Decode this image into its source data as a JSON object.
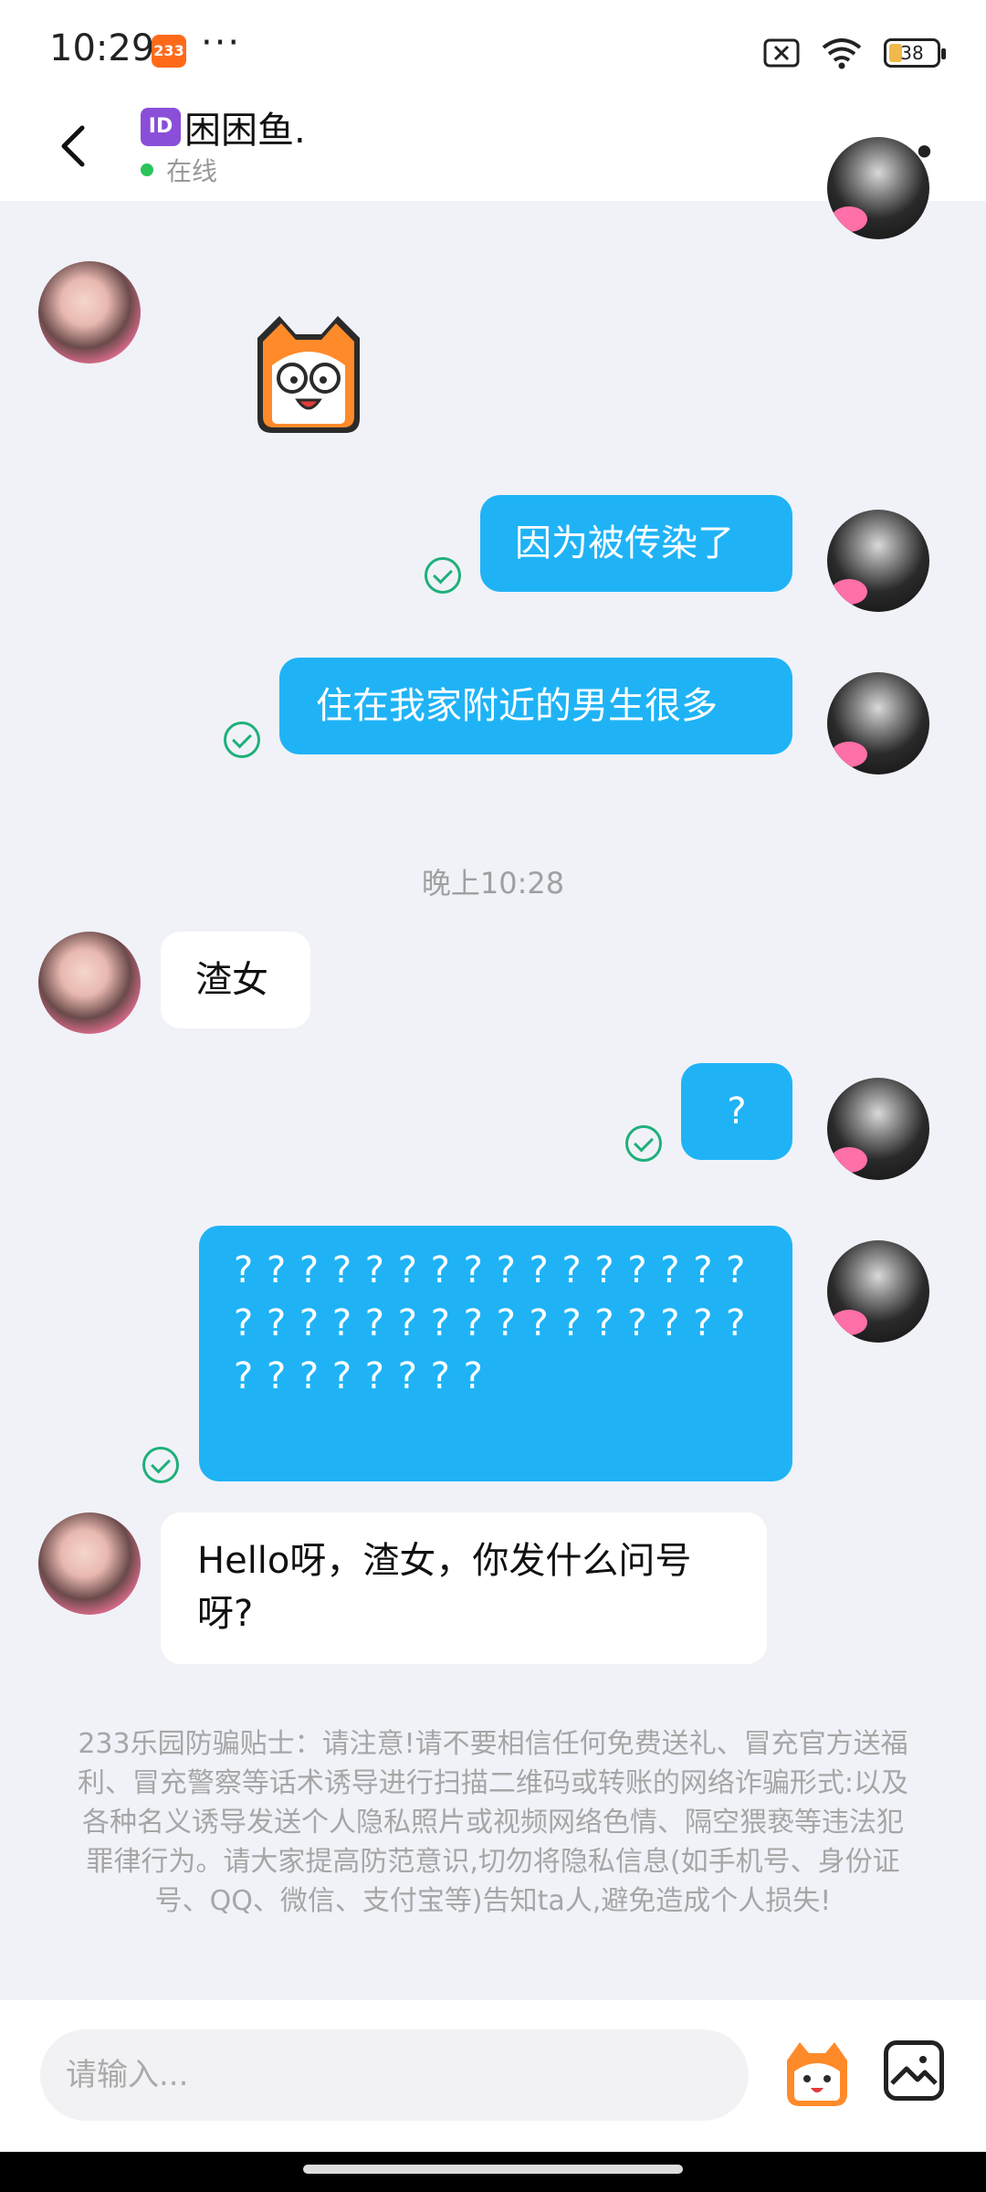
{
  "status_bar": {
    "time": "10:29",
    "app_badge": "233",
    "more": "···",
    "battery": "38"
  },
  "header": {
    "id_badge": "ID",
    "name": "困困鱼.",
    "status": "在线"
  },
  "messages": [
    {
      "side": "in",
      "type": "sticker"
    },
    {
      "side": "out",
      "text": "因为被传染了"
    },
    {
      "side": "out",
      "text": "住在我家附近的男生很多"
    },
    {
      "side": "in",
      "text": "渣女"
    },
    {
      "side": "out",
      "text": "?"
    },
    {
      "side": "out",
      "text": "? ? ? ? ? ? ? ? ? ? ? ? ? ? ? ? ? ? ? ? ? ? ? ? ? ? ? ? ? ? ? ? ? ? ? ? ? ? ? ?"
    },
    {
      "side": "in",
      "text": "Hello呀，渣女，你发什么问号呀?"
    }
  ],
  "timestamp": "晚上10:28",
  "anti_fraud_tip": "233乐园防骗贴士：请注意!请不要相信任何免费送礼、冒充官方送福利、冒充警察等话术诱导进行扫描二维码或转账的网络诈骗形式:以及各种名义诱导发送个人隐私照片或视频网络色情、隔空猥亵等违法犯罪律行为。请大家提高防范意识,切勿将隐私信息(如手机号、身份证号、QQ、微信、支付宝等)告知ta人,避免造成个人损失!",
  "input": {
    "placeholder": "请输入..."
  },
  "colors": {
    "outgoing_bubble": "#1fb3f6",
    "read_check": "#1fb07a",
    "online_dot": "#2bc45a"
  }
}
